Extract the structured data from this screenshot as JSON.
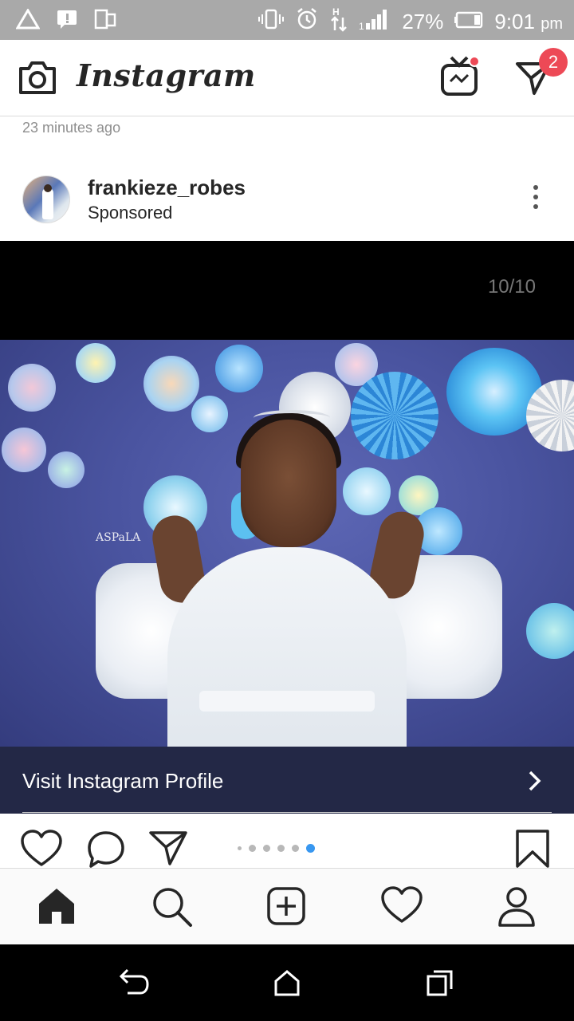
{
  "status_bar": {
    "battery": "27%",
    "time": "9:01",
    "ampm": "pm"
  },
  "header": {
    "logo": "Instagram",
    "dm_badge_count": "2",
    "icons": [
      "camera-icon",
      "igtv-icon",
      "direct-message-icon"
    ]
  },
  "feed": {
    "previous_post_time": "23 minutes ago"
  },
  "post": {
    "username": "frankieze_robes",
    "label": "Sponsored",
    "carousel_counter": "10/10",
    "photo_watermark": "ASPaLA",
    "cta": "Visit Instagram Profile",
    "carousel_total": 5,
    "carousel_active_index": 5
  },
  "bottom_nav": {
    "items": [
      "home-icon",
      "search-icon",
      "new-post-icon",
      "activity-heart-icon",
      "profile-icon"
    ]
  },
  "colors": {
    "notification_red": "#ed4956",
    "active_dot_blue": "#3897f0",
    "cta_bar": "#232846"
  }
}
